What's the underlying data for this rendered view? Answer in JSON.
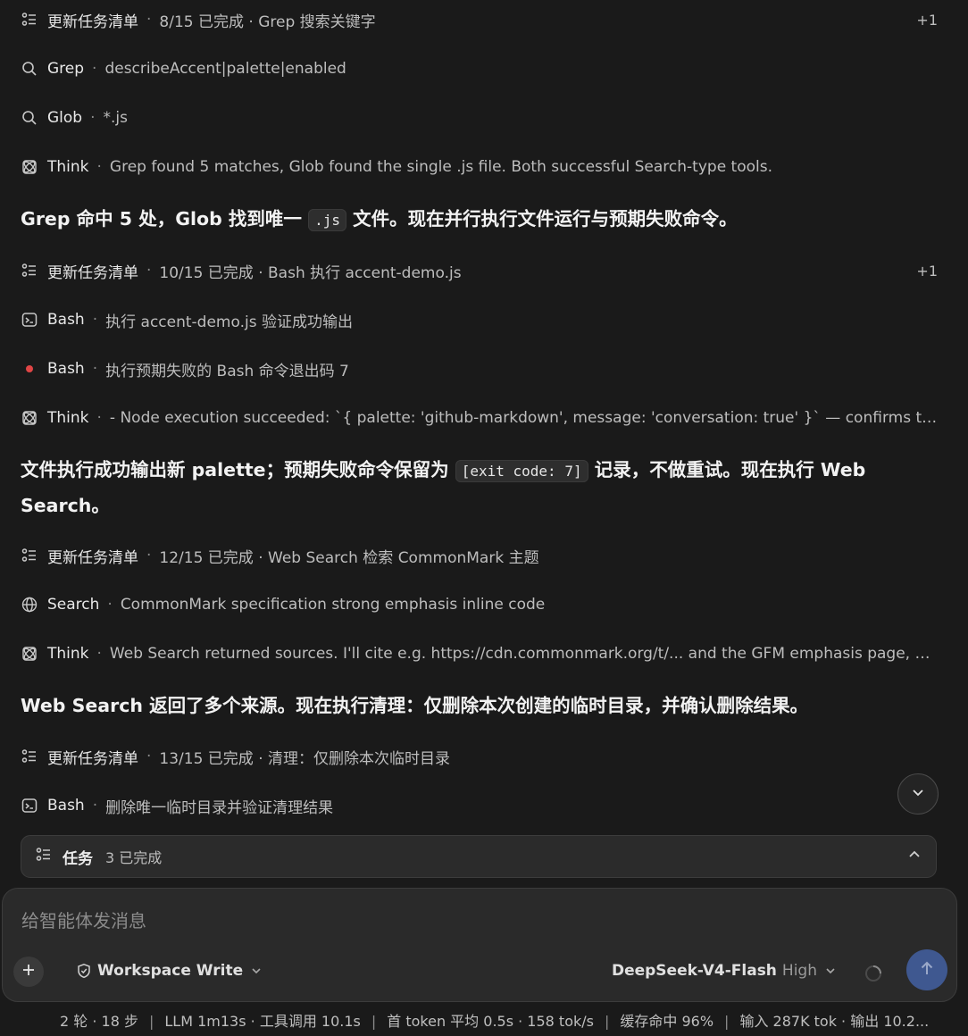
{
  "feed": {
    "rows": [
      {
        "icon": "task-list-icon",
        "name": "更新任务清单",
        "desc": "8/15 已完成 · Grep 搜索关键字",
        "badge": "+1"
      },
      {
        "icon": "search-icon",
        "name": "Grep",
        "desc": "describeAccent|palette|enabled"
      },
      {
        "icon": "search-icon",
        "name": "Glob",
        "desc": "*.js"
      },
      {
        "icon": "think-icon",
        "name": "Think",
        "desc": "Grep found 5 matches, Glob found the single .js file. Both successful Search-type tools."
      },
      {
        "icon": "task-list-icon",
        "name": "更新任务清单",
        "desc": "10/15 已完成 · Bash 执行 accent-demo.js",
        "badge": "+1"
      },
      {
        "icon": "terminal-icon",
        "name": "Bash",
        "desc": "执行 accent-demo.js 验证成功输出"
      },
      {
        "icon": "error-dot-icon",
        "name": "Bash",
        "desc": "执行预期失败的 Bash 命令退出码 7"
      },
      {
        "icon": "think-icon",
        "name": "Think",
        "desc": "- Node execution succeeded: `{ palette: 'github-markdown', message: 'conversation: true' }` — confirms the ..."
      },
      {
        "icon": "task-list-icon",
        "name": "更新任务清单",
        "desc": "12/15 已完成 · Web Search 检索 CommonMark 主题"
      },
      {
        "icon": "globe-icon",
        "name": "Search",
        "desc": "CommonMark specification strong emphasis inline code"
      },
      {
        "icon": "think-icon",
        "name": "Think",
        "desc": "Web Search returned sources. I'll cite e.g. https://cdn.commonmark.org/t/... and the GFM emphasis page, a..."
      },
      {
        "icon": "task-list-icon",
        "name": "更新任务清单",
        "desc": "13/15 已完成 · 清理：仅删除本次临时目录"
      },
      {
        "icon": "terminal-icon",
        "name": "Bash",
        "desc": "删除唯一临时目录并验证清理结果"
      }
    ],
    "messages": {
      "m1_before": "Grep 命中 5 处，Glob 找到唯一 ",
      "m1_code": ".js",
      "m1_after": " 文件。现在并行执行文件运行与预期失败命令。",
      "m2_before": "文件执行成功输出新 palette；预期失败命令保留为 ",
      "m2_code": "[exit code: 7]",
      "m2_after": " 记录，不做重试。现在执行 Web Search。",
      "m3": "Web Search 返回了多个来源。现在执行清理：仅删除本次创建的临时目录，并确认删除结果。"
    }
  },
  "task_panel": {
    "title": "任务",
    "count": "3 已完成"
  },
  "composer": {
    "placeholder": "给智能体发消息",
    "permission": "Workspace Write",
    "model": "DeepSeek-V4-Flash",
    "level": "High"
  },
  "status": {
    "items": [
      "2 轮 · 18 步",
      "LLM 1m13s · 工具调用 10.1s",
      "首 token 平均 0.5s · 158 tok/s",
      "缓存命中 96%",
      "输入 287K tok · 输出 10.2..."
    ],
    "separator": "|"
  },
  "colors": {
    "background": "#1a1a1a",
    "error_dot": "#e04545",
    "send_button": "#3f5890"
  }
}
